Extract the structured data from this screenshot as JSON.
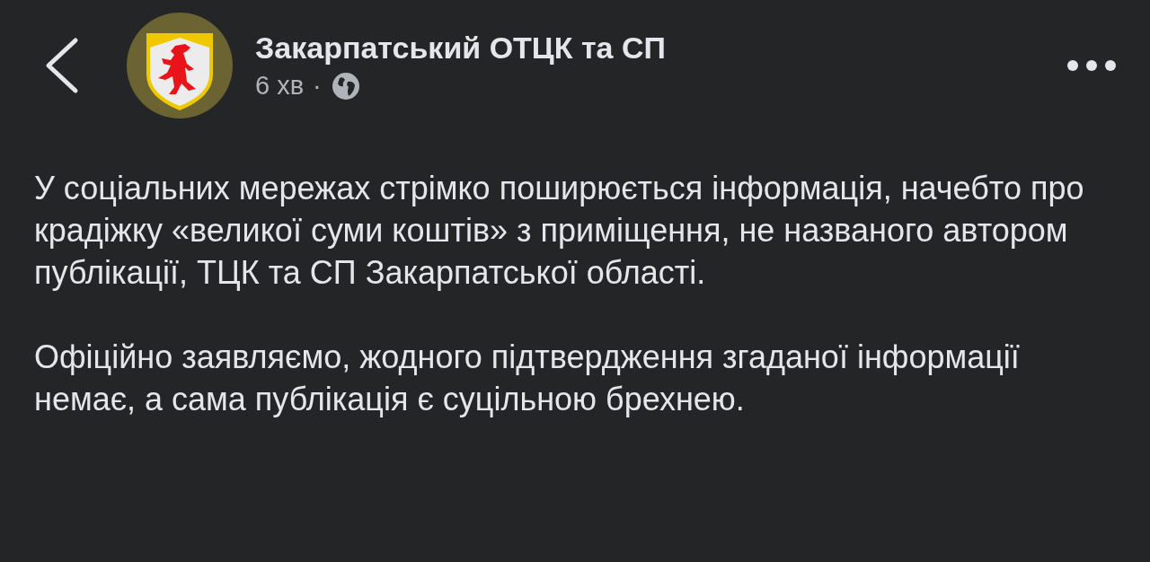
{
  "post": {
    "author": "Закарпатський ОТЦК та СП",
    "time": "6 хв",
    "separator": "·",
    "paragraphs": [
      "У соціальних мережах стрімко поширюється інформація, начебто про крадіжку «великої суми коштів» з приміщення, не названого автором публікації, ТЦК та СП Закарпатської області.",
      "Офіційно заявляємо, жодного підтвердження згаданої інформації немає, а сама публікація є суцільною брехнею."
    ]
  }
}
